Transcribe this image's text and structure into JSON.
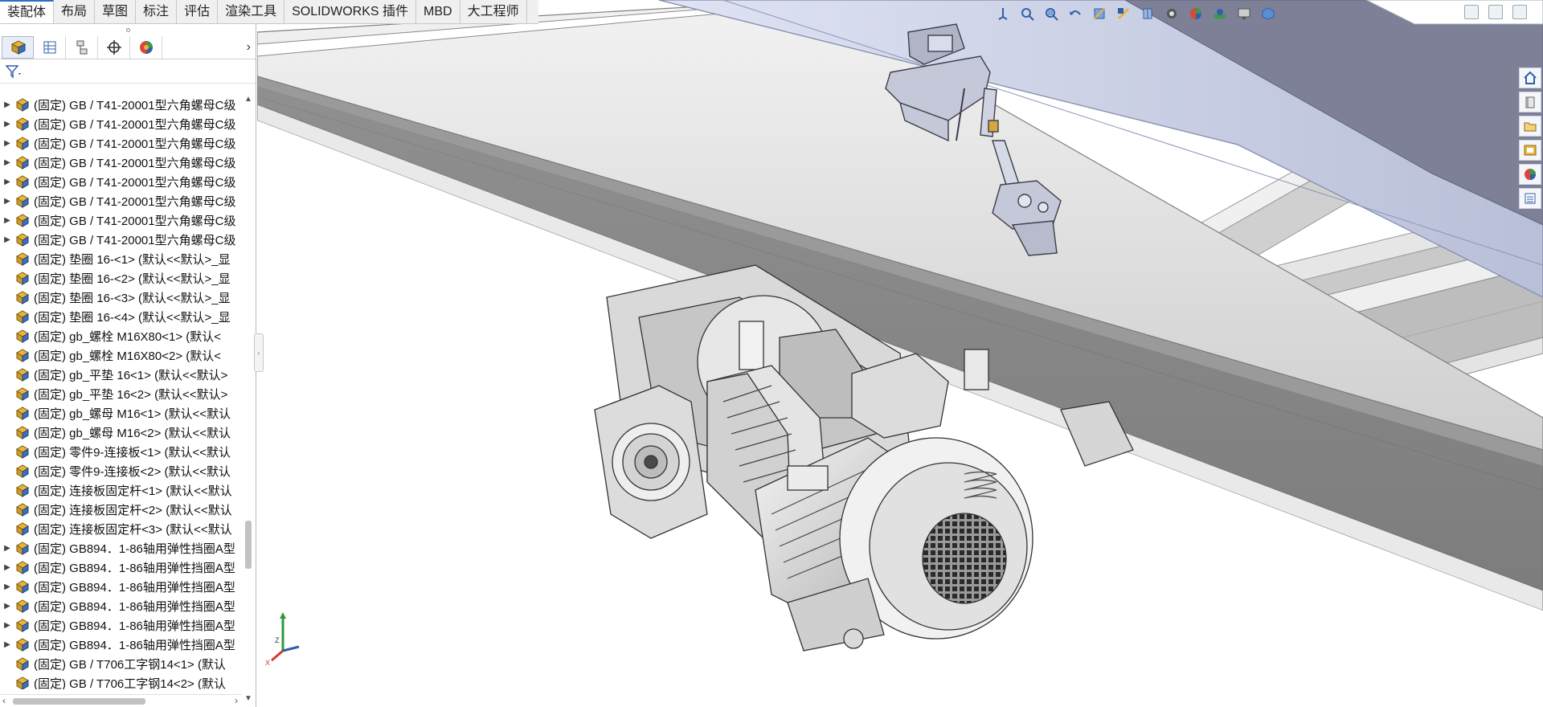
{
  "ribbon": {
    "tabs": [
      "装配体",
      "布局",
      "草图",
      "标注",
      "评估",
      "渲染工具",
      "SOLIDWORKS 插件",
      "MBD",
      "大工程师"
    ],
    "active_tab": "装配体"
  },
  "feature_tree": {
    "items": [
      {
        "label": "(固定) GB / T41-20001型六角螺母C级",
        "has_children": true
      },
      {
        "label": "(固定) GB / T41-20001型六角螺母C级",
        "has_children": true
      },
      {
        "label": "(固定) GB / T41-20001型六角螺母C级",
        "has_children": true
      },
      {
        "label": "(固定) GB / T41-20001型六角螺母C级",
        "has_children": true
      },
      {
        "label": "(固定) GB / T41-20001型六角螺母C级",
        "has_children": true
      },
      {
        "label": "(固定) GB / T41-20001型六角螺母C级",
        "has_children": true
      },
      {
        "label": "(固定) GB / T41-20001型六角螺母C级",
        "has_children": true
      },
      {
        "label": "(固定) GB / T41-20001型六角螺母C级",
        "has_children": true
      },
      {
        "label": "(固定) 垫圈 16-<1> (默认<<默认>_显",
        "has_children": false
      },
      {
        "label": "(固定) 垫圈 16-<2> (默认<<默认>_显",
        "has_children": false
      },
      {
        "label": "(固定) 垫圈 16-<3> (默认<<默认>_显",
        "has_children": false
      },
      {
        "label": "(固定) 垫圈 16-<4> (默认<<默认>_显",
        "has_children": false
      },
      {
        "label": "(固定) gb_螺栓 M16X80<1> (默认<",
        "has_children": false
      },
      {
        "label": "(固定) gb_螺栓 M16X80<2> (默认<",
        "has_children": false
      },
      {
        "label": "(固定) gb_平垫 16<1> (默认<<默认>",
        "has_children": false
      },
      {
        "label": "(固定) gb_平垫 16<2> (默认<<默认>",
        "has_children": false
      },
      {
        "label": "(固定) gb_螺母 M16<1> (默认<<默认",
        "has_children": false
      },
      {
        "label": "(固定) gb_螺母 M16<2> (默认<<默认",
        "has_children": false
      },
      {
        "label": "(固定) 零件9-连接板<1> (默认<<默认",
        "has_children": false
      },
      {
        "label": "(固定) 零件9-连接板<2> (默认<<默认",
        "has_children": false
      },
      {
        "label": "(固定) 连接板固定杆<1> (默认<<默认",
        "has_children": false
      },
      {
        "label": "(固定) 连接板固定杆<2> (默认<<默认",
        "has_children": false
      },
      {
        "label": "(固定) 连接板固定杆<3> (默认<<默认",
        "has_children": false
      },
      {
        "label": "(固定) GB894．1-86轴用弹性挡圈A型",
        "has_children": true
      },
      {
        "label": "(固定) GB894．1-86轴用弹性挡圈A型",
        "has_children": true
      },
      {
        "label": "(固定) GB894．1-86轴用弹性挡圈A型",
        "has_children": true
      },
      {
        "label": "(固定) GB894．1-86轴用弹性挡圈A型",
        "has_children": true
      },
      {
        "label": "(固定) GB894．1-86轴用弹性挡圈A型",
        "has_children": true
      },
      {
        "label": "(固定) GB894．1-86轴用弹性挡圈A型",
        "has_children": true
      },
      {
        "label": "(固定) GB / T706工字钢14<1> (默认",
        "has_children": false
      },
      {
        "label": "(固定) GB / T706工字钢14<2> (默认",
        "has_children": false
      }
    ]
  },
  "icons": {
    "panel_tabs": [
      "feature-manager-icon",
      "property-manager-icon",
      "configuration-manager-icon",
      "dimxpert-icon",
      "display-manager-icon"
    ],
    "heads_up": [
      "view-orientation-icon",
      "zoom-to-fit-icon",
      "zoom-area-icon",
      "previous-view-icon",
      "section-view-icon",
      "dynamic-annotation-icon",
      "view-display-icon",
      "hide-show-icon",
      "edit-appearance-icon",
      "apply-scene-icon",
      "view-settings-icon",
      "display-style-icon"
    ],
    "task_pane": [
      "home-icon",
      "design-library-icon",
      "file-explorer-icon",
      "view-palette-icon",
      "appearances-icon",
      "custom-properties-icon"
    ]
  },
  "colors": {
    "accent": "#2f6fc0",
    "part_icon_yellow": "#e8b53a",
    "part_icon_blue": "#3f6fb7",
    "beam_dark": "#8e8e8e",
    "beam_light": "#d6d6d6",
    "rail_blue": "#c5cbe3"
  }
}
